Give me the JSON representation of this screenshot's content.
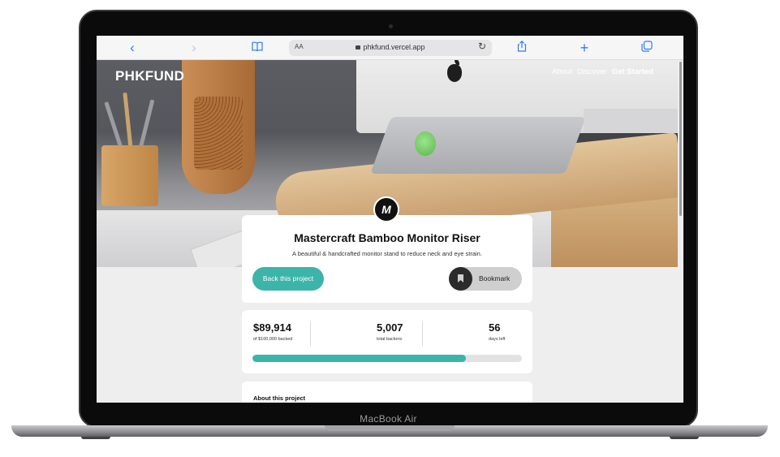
{
  "device": {
    "model": "MacBook Air"
  },
  "browser": {
    "url": "phkfund.vercel.app",
    "text_size_label": "AA",
    "icons": [
      "back-icon",
      "forward-icon",
      "book-icon",
      "lock-icon",
      "reload-icon",
      "share-icon",
      "new-tab-icon",
      "tabs-icon"
    ]
  },
  "site": {
    "brand": "PHKFUND",
    "nav": [
      "About",
      "Discover",
      "Get Started"
    ],
    "accent_color": "#3cb4a9"
  },
  "project": {
    "logo_letter": "M",
    "title": "Mastercraft Bamboo Monitor Riser",
    "description": "A beautiful & handcrafted monitor stand to reduce neck and eye strain.",
    "back_button": "Back this project",
    "bookmark_button": "Bookmark"
  },
  "stats": {
    "backed": {
      "value": "$89,914",
      "label": "of $100,000 backed"
    },
    "backers": {
      "value": "5,007",
      "label": "total backers"
    },
    "days": {
      "value": "56",
      "label": "days left"
    },
    "progress_fraction": 0.899
  },
  "about": {
    "title": "About this project"
  }
}
